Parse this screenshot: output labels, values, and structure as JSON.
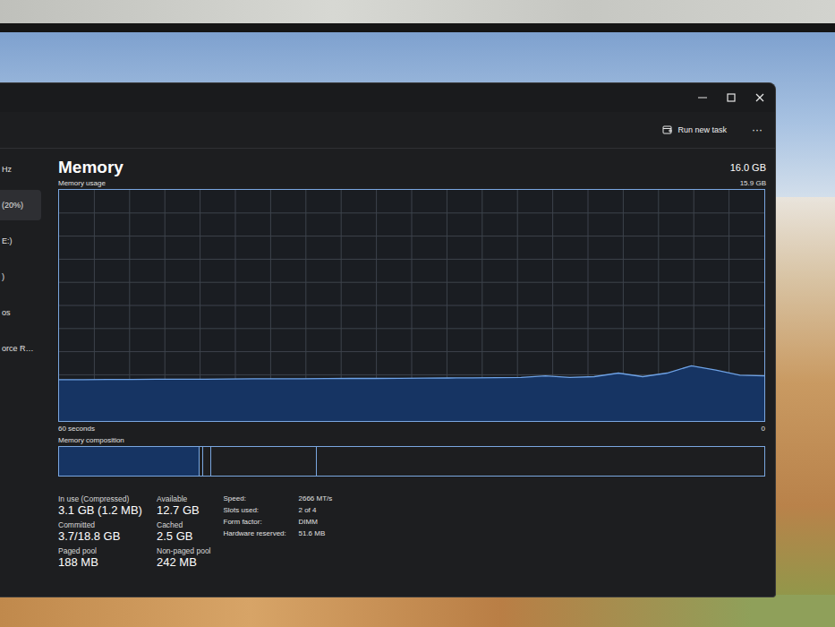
{
  "window": {
    "more": "···",
    "toolbar": {
      "run_task": "Run new task"
    }
  },
  "sidebar": {
    "items": [
      {
        "label": "Hz",
        "selected": false
      },
      {
        "label": "(20%)",
        "selected": true
      },
      {
        "label": "E:)",
        "selected": false
      },
      {
        "label": ")",
        "selected": false
      },
      {
        "label": "os",
        "selected": false
      },
      {
        "label": "orce R…",
        "selected": false
      }
    ]
  },
  "memory": {
    "title": "Memory",
    "total": "16.0 GB",
    "usage_label": "Memory usage",
    "max_label": "15.9 GB",
    "time_label": "60 seconds",
    "zero_label": "0",
    "composition_label": "Memory composition"
  },
  "chart": {
    "series": [
      2.85,
      2.85,
      2.86,
      2.86,
      2.87,
      2.88,
      2.88,
      2.89,
      2.9,
      2.9,
      2.91,
      2.92,
      2.93,
      2.93,
      2.94,
      2.95,
      2.96,
      2.97,
      2.98,
      3.0,
      3.1,
      3.0,
      3.05,
      3.3,
      3.05,
      3.3,
      3.8,
      3.5,
      3.15,
      3.1
    ]
  },
  "composition": [
    {
      "kind": "in-use",
      "level": 0.2
    },
    {
      "kind": "modified",
      "level": 0.01
    },
    {
      "kind": "standby",
      "level": 0.15
    },
    {
      "kind": "free",
      "level": 0.64
    }
  ],
  "stats": [
    {
      "label": "In use (Compressed)",
      "value": "3.1 GB (1.2 MB)"
    },
    {
      "label": "Available",
      "value": "12.7 GB"
    },
    {
      "label": "Committed",
      "value": "3.7/18.8 GB"
    },
    {
      "label": "Cached",
      "value": "2.5 GB"
    },
    {
      "label": "Paged pool",
      "value": "188 MB"
    },
    {
      "label": "Non-paged pool",
      "value": "242 MB"
    }
  ],
  "specs": [
    {
      "label": "Speed:",
      "value": "2666 MT/s"
    },
    {
      "label": "Slots used:",
      "value": "2 of 4"
    },
    {
      "label": "Form factor:",
      "value": "DIMM"
    },
    {
      "label": "Hardware reserved:",
      "value": "51.6 MB"
    }
  ]
}
